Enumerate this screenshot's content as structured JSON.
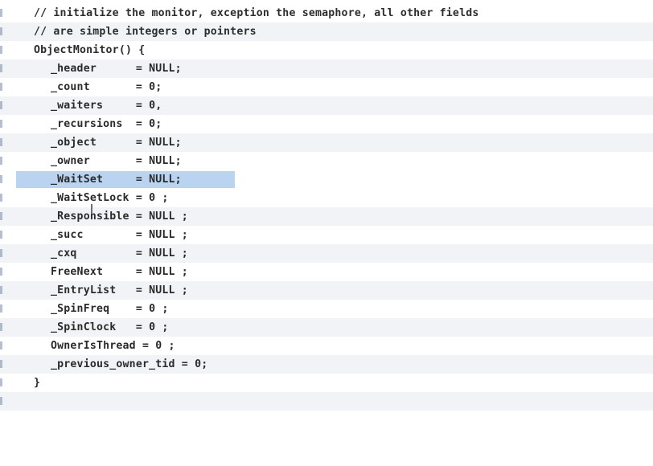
{
  "editor": {
    "lines": [
      {
        "text": "// initialize the monitor, exception the semaphore, all other fields",
        "indent": 42
      },
      {
        "text": "// are simple integers or pointers",
        "indent": 42
      },
      {
        "text": "ObjectMonitor() {",
        "indent": 42
      },
      {
        "text": "_header      = NULL;",
        "indent": 63
      },
      {
        "text": "_count       = 0;",
        "indent": 63
      },
      {
        "text": "_waiters     = 0,",
        "indent": 63
      },
      {
        "text": "_recursions  = 0;",
        "indent": 63
      },
      {
        "text": "_object      = NULL;",
        "indent": 63
      },
      {
        "text": "_owner       = NULL;",
        "indent": 63
      },
      {
        "text": "_WaitSet     = NULL;",
        "indent": 63
      },
      {
        "text": "_WaitSetLock = 0 ;",
        "indent": 63
      },
      {
        "text": "_Responsible = NULL ;",
        "indent": 63
      },
      {
        "text": "_succ        = NULL ;",
        "indent": 63
      },
      {
        "text": "_cxq         = NULL ;",
        "indent": 63
      },
      {
        "text": "FreeNext     = NULL ;",
        "indent": 63
      },
      {
        "text": "_EntryList   = NULL ;",
        "indent": 63
      },
      {
        "text": "_SpinFreq    = 0 ;",
        "indent": 63
      },
      {
        "text": "_SpinClock   = 0 ;",
        "indent": 63
      },
      {
        "text": "OwnerIsThread = 0 ;",
        "indent": 63
      },
      {
        "text": "_previous_owner_tid = 0;",
        "indent": 63
      },
      {
        "text": "}",
        "indent": 42
      },
      {
        "text": "",
        "indent": 42
      }
    ],
    "highlighted_line": 9,
    "highlight_color": "#b9d3f0"
  }
}
